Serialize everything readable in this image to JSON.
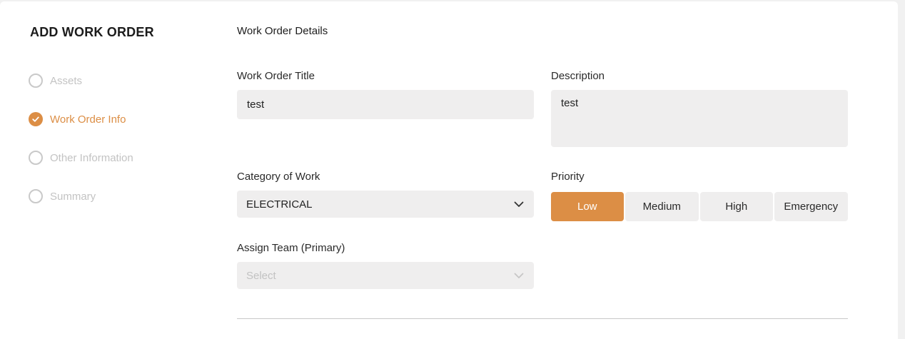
{
  "header": {
    "title": "ADD WORK ORDER"
  },
  "steps": [
    {
      "label": "Assets",
      "state": "inactive"
    },
    {
      "label": "Work Order Info",
      "state": "active"
    },
    {
      "label": "Other Information",
      "state": "inactive"
    },
    {
      "label": "Summary",
      "state": "inactive"
    }
  ],
  "form": {
    "section_title": "Work Order Details",
    "title": {
      "label": "Work Order Title",
      "value": "test"
    },
    "description": {
      "label": "Description",
      "value": "test"
    },
    "category": {
      "label": "Category of Work",
      "value": "ELECTRICAL"
    },
    "priority": {
      "label": "Priority",
      "options": [
        "Low",
        "Medium",
        "High",
        "Emergency"
      ],
      "selected": "Low"
    },
    "team": {
      "label": "Assign Team (Primary)",
      "placeholder": "Select"
    }
  },
  "colors": {
    "accent": "#dc8e45",
    "field_bg": "#efeeee",
    "inactive_text": "#c3c3c3"
  },
  "icons": {
    "step_complete": "check-circle-icon",
    "step_pending": "empty-circle-icon",
    "dropdown": "chevron-down-icon"
  }
}
